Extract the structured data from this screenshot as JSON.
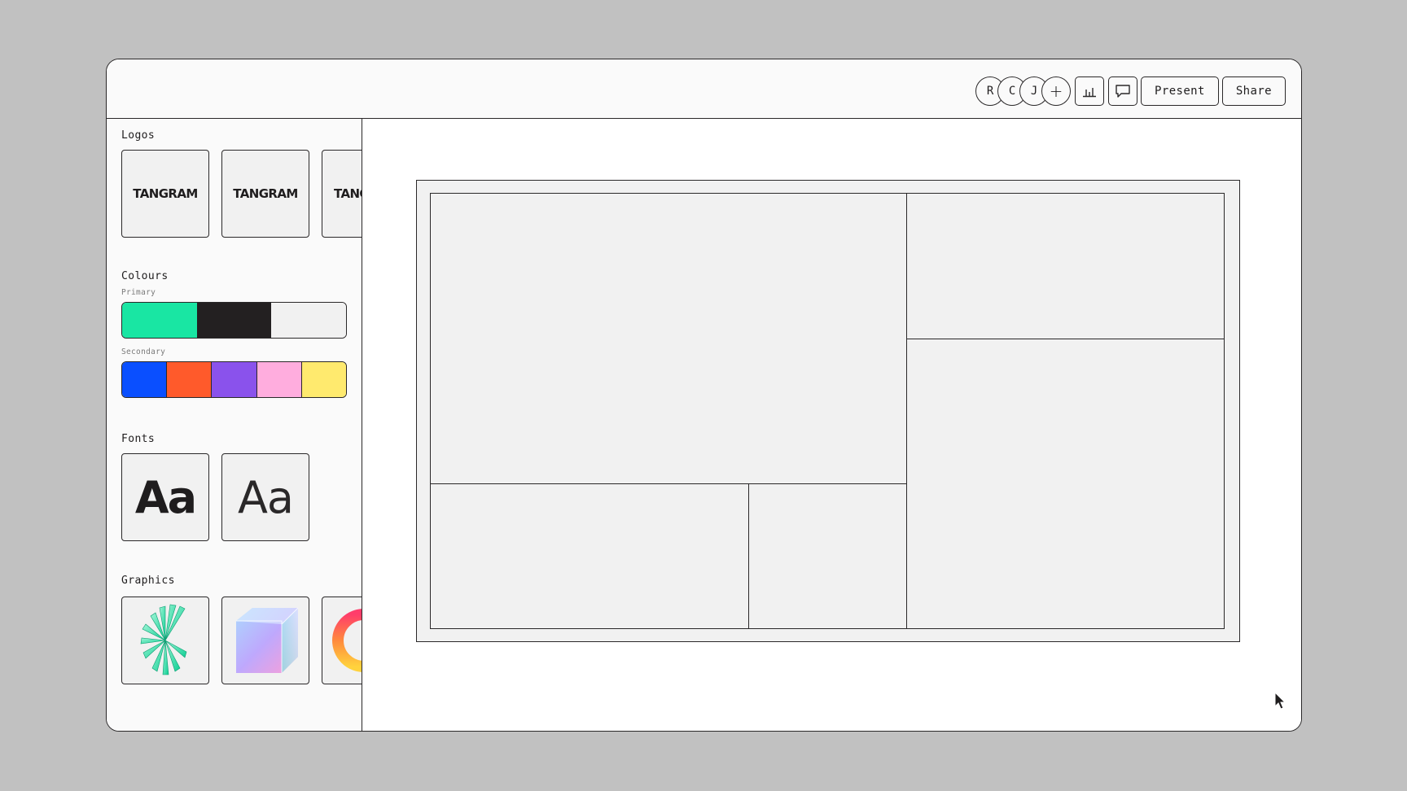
{
  "toolbar": {
    "avatars": [
      "R",
      "C",
      "J"
    ],
    "add_collaborator": "+",
    "analytics_icon": "bar-chart-icon",
    "comments_icon": "speech-bubble-icon",
    "present_label": "Present",
    "share_label": "Share"
  },
  "sidebar": {
    "logos": {
      "title": "Logos",
      "items": [
        "TANGRAM",
        "TANGRAM",
        "TANGRAM"
      ]
    },
    "colours": {
      "title": "Colours",
      "primary_label": "Primary",
      "primary": [
        "#19e6a3",
        "#232021",
        "#f1f1f1"
      ],
      "secondary_label": "Secondary",
      "secondary": [
        "#0a4fff",
        "#ff5a2b",
        "#8a52ec",
        "#ffadde",
        "#ffea6e"
      ]
    },
    "fonts": {
      "title": "Fonts",
      "samples": [
        "Aa",
        "Aa"
      ]
    },
    "graphics": {
      "title": "Graphics",
      "items": [
        "fan-ribbon-graphic",
        "glass-cube-graphic",
        "gradient-ring-graphic"
      ]
    }
  },
  "canvas": {
    "layout": "empty-bento-grid-frame",
    "panels": 5
  }
}
